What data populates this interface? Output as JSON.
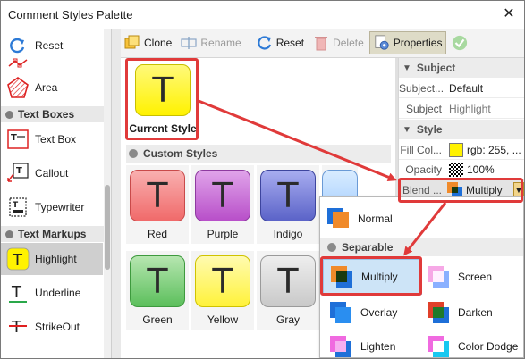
{
  "window": {
    "title": "Comment Styles Palette",
    "close_glyph": "✕"
  },
  "left_panel": {
    "top_tool": {
      "label": "Reset",
      "icon": "reset-icon"
    },
    "tools_a": [
      {
        "label": "",
        "icon": "polyline-icon"
      },
      {
        "label": "Area",
        "icon": "area-icon"
      }
    ],
    "group_text_boxes": "Text Boxes",
    "tools_b": [
      {
        "label": "Text Box",
        "icon": "text-box-icon"
      },
      {
        "label": "Callout",
        "icon": "callout-icon"
      },
      {
        "label": "Typewriter",
        "icon": "typewriter-icon"
      }
    ],
    "group_text_markups": "Text Markups",
    "tools_c": [
      {
        "label": "Highlight",
        "icon": "highlight-icon"
      },
      {
        "label": "Underline",
        "icon": "underline-icon"
      },
      {
        "label": "StrikeOut",
        "icon": "strikeout-icon"
      }
    ]
  },
  "toolbar": {
    "clone": "Clone",
    "rename": "Rename",
    "reset": "Reset",
    "delete": "Delete",
    "properties": "Properties"
  },
  "center": {
    "current_style": {
      "label": "Current Style",
      "glyph": "T",
      "color": "#fff200"
    },
    "custom_header": "Custom Styles",
    "styles": [
      {
        "label": "Red",
        "glyph": "T",
        "color": "#f06a6a"
      },
      {
        "label": "Purple",
        "glyph": "T",
        "color": "#b84fc9"
      },
      {
        "label": "Indigo",
        "glyph": "T",
        "color": "#5b63c8"
      },
      {
        "label": "Green",
        "glyph": "T",
        "color": "#5cbf5c"
      },
      {
        "label": "Yellow",
        "glyph": "T",
        "color": "#fff23a"
      },
      {
        "label": "Gray",
        "glyph": "T",
        "color": "#c9c9c9"
      }
    ]
  },
  "properties": {
    "subject_header": "Subject",
    "subject_rows": [
      {
        "key": "Subject...",
        "value": "Default"
      },
      {
        "key": "Subject",
        "value": "Highlight"
      }
    ],
    "style_header": "Style",
    "fill_key": "Fill Col...",
    "fill_value": "rgb: 255, ...",
    "fill_color": "#fff200",
    "opacity_key": "Opacity",
    "opacity_value": "100%",
    "blend_key": "Blend ...",
    "blend_value": "Multiply"
  },
  "blend_menu": {
    "normal": "Normal",
    "separable_header": "Separable",
    "items": [
      {
        "label": "Multiply"
      },
      {
        "label": "Screen"
      },
      {
        "label": "Overlay"
      },
      {
        "label": "Darken"
      },
      {
        "label": "Lighten"
      },
      {
        "label": "Color Dodge"
      }
    ]
  }
}
